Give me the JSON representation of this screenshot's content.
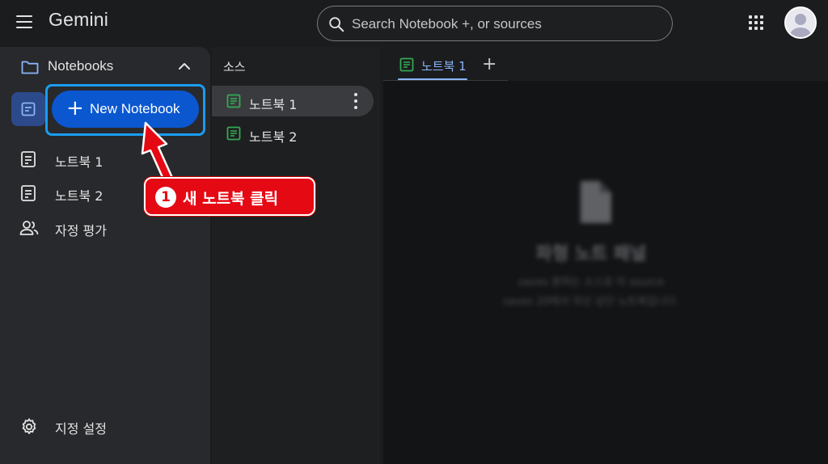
{
  "app": {
    "title": "Gemini"
  },
  "search": {
    "placeholder": "Search Notebook +, or sources"
  },
  "sidebar": {
    "section_label": "Notebooks",
    "new_button_label": "New Notebook",
    "items": [
      {
        "label": "노트북 1",
        "icon": "document-icon"
      },
      {
        "label": "노트북 2",
        "icon": "document-icon"
      },
      {
        "label": "자정 평가",
        "icon": "people-icon"
      }
    ],
    "settings_label": "지정 설정"
  },
  "sources": {
    "title": "소스",
    "items": [
      {
        "label": "노트북 1",
        "active": true
      },
      {
        "label": "노트북 2",
        "active": false
      }
    ]
  },
  "content": {
    "active_tab": "노트북 1",
    "empty_title": "파형 노트 패널",
    "empty_desc_line1": "saves 원하는 소스로 이 source",
    "empty_desc_line2": "saves 20에서 자신 상단 노트북입니다."
  },
  "annotation": {
    "step_number": "1",
    "text": "새 노트북 클릭"
  },
  "colors": {
    "accent_blue": "#0b57d0",
    "highlight": "#1a9cf0",
    "callout_red": "#e50914",
    "doc_green": "#34a853",
    "tab_blue": "#8ab4f8"
  }
}
